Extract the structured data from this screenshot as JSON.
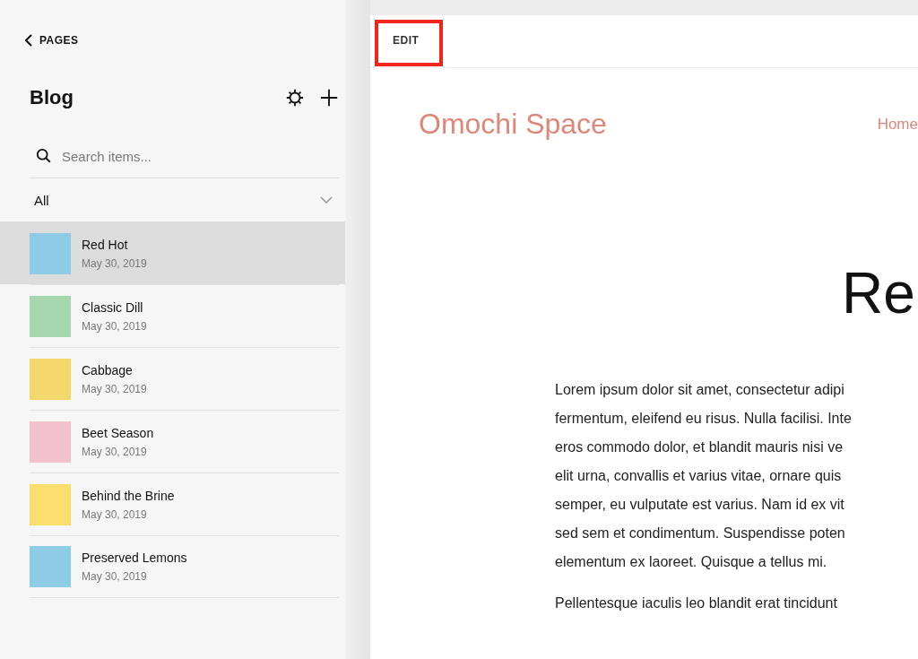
{
  "sidebar": {
    "back_link": "PAGES",
    "title": "Blog",
    "search": {
      "placeholder": "Search items..."
    },
    "filter": {
      "value": "All"
    },
    "items": [
      {
        "title": "Red Hot",
        "date": "May 30, 2019",
        "color": "#8ecbe6",
        "selected": true
      },
      {
        "title": "Classic Dill",
        "date": "May 30, 2019",
        "color": "#a6d6ac",
        "selected": false
      },
      {
        "title": "Cabbage",
        "date": "May 30, 2019",
        "color": "#f3d86c",
        "selected": false
      },
      {
        "title": "Beet Season",
        "date": "May 30, 2019",
        "color": "#f2c1cb",
        "selected": false
      },
      {
        "title": "Behind the Brine",
        "date": "May 30, 2019",
        "color": "#fbdf6e",
        "selected": false
      },
      {
        "title": "Preserved Lemons",
        "date": "May 30, 2019",
        "color": "#8ecbe6",
        "selected": false
      }
    ]
  },
  "preview": {
    "edit_button": {
      "label": "EDIT",
      "highlighted": true
    },
    "site_title": "Omochi Space",
    "nav": [
      "Home"
    ],
    "page_title": "Re",
    "paragraphs": [
      [
        "Lorem ipsum dolor sit amet, consectetur adipi",
        "fermentum, eleifend eu risus. Nulla facilisi. Inte",
        "eros commodo dolor, et blandit mauris nisi ve",
        "elit urna, convallis et varius vitae, ornare quis",
        "semper, eu vulputate est varius. Nam id ex vit",
        "sed sem et condimentum. Suspendisse poten",
        "elementum ex laoreet. Quisque a tellus mi."
      ],
      [
        "Pellentesque iaculis leo blandit erat tincidunt"
      ]
    ]
  }
}
